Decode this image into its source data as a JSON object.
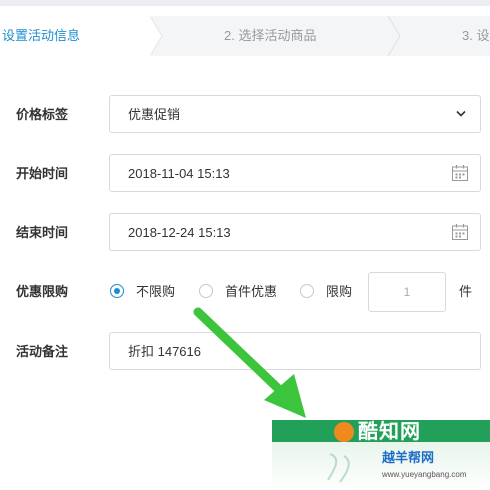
{
  "steps": [
    {
      "label": "设置活动信息",
      "active": true
    },
    {
      "label": "2. 选择活动商品",
      "active": false
    },
    {
      "label": "3. 设",
      "active": false
    }
  ],
  "form": {
    "price_tag": {
      "label": "价格标签",
      "value": "优惠促销"
    },
    "start_time": {
      "label": "开始时间",
      "value": "2018-11-04 15:13"
    },
    "end_time": {
      "label": "结束时间",
      "value": "2018-12-24 15:13"
    },
    "limit": {
      "label": "优惠限购",
      "options": [
        {
          "label": "不限购",
          "selected": true
        },
        {
          "label": "首件优惠",
          "selected": false
        },
        {
          "label": "限购",
          "selected": false
        }
      ],
      "qty_placeholder": "1",
      "unit": "件"
    },
    "note": {
      "label": "活动备注",
      "value": "折扣 147616"
    }
  },
  "watermark": {
    "name": "酷知网",
    "site": "越羊帮网",
    "url": "www.yueyangbang.com"
  },
  "colors": {
    "accent": "#1c8fd2",
    "arrow": "#3cc43c",
    "watermark_green": "#22a05a"
  },
  "icons": {
    "select": "chevron-down-icon",
    "date": "calendar-icon"
  }
}
